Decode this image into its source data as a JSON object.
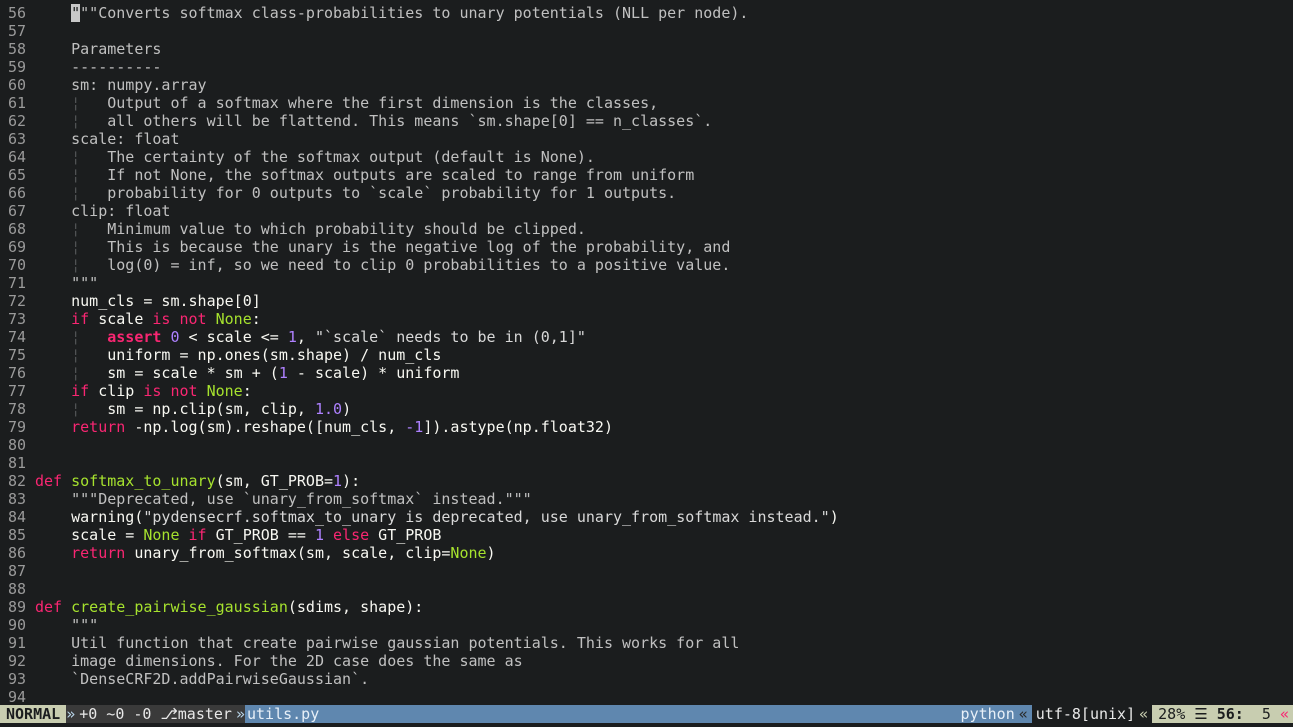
{
  "editor": {
    "lines": [
      {
        "n": "56",
        "tokens": [
          {
            "c": "t-plain",
            "t": "    "
          },
          {
            "c": "t-cursor",
            "t": "\""
          },
          {
            "c": "t-cm",
            "t": "\"\"Converts softmax class-probabilities to unary potentials (NLL per node)."
          }
        ]
      },
      {
        "n": "57",
        "tokens": []
      },
      {
        "n": "58",
        "tokens": [
          {
            "c": "t-cm",
            "t": "    Parameters"
          }
        ]
      },
      {
        "n": "59",
        "tokens": [
          {
            "c": "t-cm",
            "t": "    ----------"
          }
        ]
      },
      {
        "n": "60",
        "tokens": [
          {
            "c": "t-cm",
            "t": "    sm: numpy.array"
          }
        ]
      },
      {
        "n": "61",
        "tokens": [
          {
            "c": "t-plain",
            "t": "    "
          },
          {
            "c": "t-guide",
            "t": "¦"
          },
          {
            "c": "t-cm",
            "t": "   Output of a softmax where the first dimension is the classes,"
          }
        ]
      },
      {
        "n": "62",
        "tokens": [
          {
            "c": "t-plain",
            "t": "    "
          },
          {
            "c": "t-guide",
            "t": "¦"
          },
          {
            "c": "t-cm",
            "t": "   all others will be flattend. This means `sm.shape[0] == n_classes`."
          }
        ]
      },
      {
        "n": "63",
        "tokens": [
          {
            "c": "t-cm",
            "t": "    scale: float"
          }
        ]
      },
      {
        "n": "64",
        "tokens": [
          {
            "c": "t-plain",
            "t": "    "
          },
          {
            "c": "t-guide",
            "t": "¦"
          },
          {
            "c": "t-cm",
            "t": "   The certainty of the softmax output (default is None)."
          }
        ]
      },
      {
        "n": "65",
        "tokens": [
          {
            "c": "t-plain",
            "t": "    "
          },
          {
            "c": "t-guide",
            "t": "¦"
          },
          {
            "c": "t-cm",
            "t": "   If not None, the softmax outputs are scaled to range from uniform"
          }
        ]
      },
      {
        "n": "66",
        "tokens": [
          {
            "c": "t-plain",
            "t": "    "
          },
          {
            "c": "t-guide",
            "t": "¦"
          },
          {
            "c": "t-cm",
            "t": "   probability for 0 outputs to `scale` probability for 1 outputs."
          }
        ]
      },
      {
        "n": "67",
        "tokens": [
          {
            "c": "t-cm",
            "t": "    clip: float"
          }
        ]
      },
      {
        "n": "68",
        "tokens": [
          {
            "c": "t-plain",
            "t": "    "
          },
          {
            "c": "t-guide",
            "t": "¦"
          },
          {
            "c": "t-cm",
            "t": "   Minimum value to which probability should be clipped."
          }
        ]
      },
      {
        "n": "69",
        "tokens": [
          {
            "c": "t-plain",
            "t": "    "
          },
          {
            "c": "t-guide",
            "t": "¦"
          },
          {
            "c": "t-cm",
            "t": "   This is because the unary is the negative log of the probability, and"
          }
        ]
      },
      {
        "n": "70",
        "tokens": [
          {
            "c": "t-plain",
            "t": "    "
          },
          {
            "c": "t-guide",
            "t": "¦"
          },
          {
            "c": "t-cm",
            "t": "   log(0) = inf, so we need to clip 0 probabilities to a positive value."
          }
        ]
      },
      {
        "n": "71",
        "tokens": [
          {
            "c": "t-cm",
            "t": "    \"\"\""
          }
        ]
      },
      {
        "n": "72",
        "tokens": [
          {
            "c": "t-plain",
            "t": "    num_cls = sm.shape[0]"
          }
        ]
      },
      {
        "n": "73",
        "tokens": [
          {
            "c": "t-plain",
            "t": "    "
          },
          {
            "c": "t-kw",
            "t": "if"
          },
          {
            "c": "t-plain",
            "t": " scale "
          },
          {
            "c": "t-kw",
            "t": "is not"
          },
          {
            "c": "t-plain",
            "t": " "
          },
          {
            "c": "t-fn",
            "t": "None"
          },
          {
            "c": "t-plain",
            "t": ":"
          }
        ]
      },
      {
        "n": "74",
        "tokens": [
          {
            "c": "t-plain",
            "t": "    "
          },
          {
            "c": "t-guide",
            "t": "¦"
          },
          {
            "c": "t-plain",
            "t": "   "
          },
          {
            "c": "t-kwbold",
            "t": "assert"
          },
          {
            "c": "t-plain",
            "t": " "
          },
          {
            "c": "t-num",
            "t": "0"
          },
          {
            "c": "t-plain",
            "t": " < scale <= "
          },
          {
            "c": "t-num",
            "t": "1"
          },
          {
            "c": "t-plain",
            "t": ", "
          },
          {
            "c": "t-str",
            "t": "\"`scale` needs to be in (0,1]\""
          }
        ]
      },
      {
        "n": "75",
        "tokens": [
          {
            "c": "t-plain",
            "t": "    "
          },
          {
            "c": "t-guide",
            "t": "¦"
          },
          {
            "c": "t-plain",
            "t": "   uniform = np.ones(sm.shape) / num_cls"
          }
        ]
      },
      {
        "n": "76",
        "tokens": [
          {
            "c": "t-plain",
            "t": "    "
          },
          {
            "c": "t-guide",
            "t": "¦"
          },
          {
            "c": "t-plain",
            "t": "   sm = scale * sm + ("
          },
          {
            "c": "t-num",
            "t": "1"
          },
          {
            "c": "t-plain",
            "t": " - scale) * uniform"
          }
        ]
      },
      {
        "n": "77",
        "tokens": [
          {
            "c": "t-plain",
            "t": "    "
          },
          {
            "c": "t-kw",
            "t": "if"
          },
          {
            "c": "t-plain",
            "t": " clip "
          },
          {
            "c": "t-kw",
            "t": "is not"
          },
          {
            "c": "t-plain",
            "t": " "
          },
          {
            "c": "t-fn",
            "t": "None"
          },
          {
            "c": "t-plain",
            "t": ":"
          }
        ]
      },
      {
        "n": "78",
        "tokens": [
          {
            "c": "t-plain",
            "t": "    "
          },
          {
            "c": "t-guide",
            "t": "¦"
          },
          {
            "c": "t-plain",
            "t": "   sm = np.clip(sm, clip, "
          },
          {
            "c": "t-num",
            "t": "1.0"
          },
          {
            "c": "t-plain",
            "t": ")"
          }
        ]
      },
      {
        "n": "79",
        "tokens": [
          {
            "c": "t-plain",
            "t": "    "
          },
          {
            "c": "t-kw",
            "t": "return"
          },
          {
            "c": "t-plain",
            "t": " -np.log(sm).reshape([num_cls, "
          },
          {
            "c": "t-num",
            "t": "-1"
          },
          {
            "c": "t-plain",
            "t": "]).astype(np.float32)"
          }
        ]
      },
      {
        "n": "80",
        "tokens": []
      },
      {
        "n": "81",
        "tokens": []
      },
      {
        "n": "82",
        "tokens": [
          {
            "c": "t-kw",
            "t": "def"
          },
          {
            "c": "t-plain",
            "t": " "
          },
          {
            "c": "t-fn",
            "t": "softmax_to_unary"
          },
          {
            "c": "t-plain",
            "t": "(sm, GT_PROB="
          },
          {
            "c": "t-num",
            "t": "1"
          },
          {
            "c": "t-plain",
            "t": "):"
          }
        ]
      },
      {
        "n": "83",
        "tokens": [
          {
            "c": "t-cm",
            "t": "    \"\"\"Deprecated, use `unary_from_softmax` instead.\"\"\""
          }
        ]
      },
      {
        "n": "84",
        "tokens": [
          {
            "c": "t-plain",
            "t": "    warning("
          },
          {
            "c": "t-str",
            "t": "\"pydensecrf.softmax_to_unary is deprecated, use unary_from_softmax instead.\""
          },
          {
            "c": "t-plain",
            "t": ")"
          }
        ]
      },
      {
        "n": "85",
        "tokens": [
          {
            "c": "t-plain",
            "t": "    scale = "
          },
          {
            "c": "t-fn",
            "t": "None"
          },
          {
            "c": "t-plain",
            "t": " "
          },
          {
            "c": "t-kw",
            "t": "if"
          },
          {
            "c": "t-plain",
            "t": " GT_PROB == "
          },
          {
            "c": "t-num",
            "t": "1"
          },
          {
            "c": "t-plain",
            "t": " "
          },
          {
            "c": "t-kw",
            "t": "else"
          },
          {
            "c": "t-plain",
            "t": " GT_PROB"
          }
        ]
      },
      {
        "n": "86",
        "tokens": [
          {
            "c": "t-plain",
            "t": "    "
          },
          {
            "c": "t-kw",
            "t": "return"
          },
          {
            "c": "t-plain",
            "t": " unary_from_softmax(sm, scale, clip="
          },
          {
            "c": "t-fn",
            "t": "None"
          },
          {
            "c": "t-plain",
            "t": ")"
          }
        ]
      },
      {
        "n": "87",
        "tokens": []
      },
      {
        "n": "88",
        "tokens": []
      },
      {
        "n": "89",
        "tokens": [
          {
            "c": "t-kw",
            "t": "def"
          },
          {
            "c": "t-plain",
            "t": " "
          },
          {
            "c": "t-fn",
            "t": "create_pairwise_gaussian"
          },
          {
            "c": "t-plain",
            "t": "(sdims, shape):"
          }
        ]
      },
      {
        "n": "90",
        "tokens": [
          {
            "c": "t-cm",
            "t": "    \"\"\""
          }
        ]
      },
      {
        "n": "91",
        "tokens": [
          {
            "c": "t-cm",
            "t": "    Util function that create pairwise gaussian potentials. This works for all"
          }
        ]
      },
      {
        "n": "92",
        "tokens": [
          {
            "c": "t-cm",
            "t": "    image dimensions. For the 2D case does the same as"
          }
        ]
      },
      {
        "n": "93",
        "tokens": [
          {
            "c": "t-cm",
            "t": "    `DenseCRF2D.addPairwiseGaussian`."
          }
        ]
      },
      {
        "n": "94",
        "tokens": []
      }
    ]
  },
  "statusline": {
    "mode": "NORMAL",
    "sep_mode": "»",
    "git": "+0 ~0 -0 ⎇master",
    "sep_git": "»",
    "file": "utils.py",
    "filetype": "python",
    "sep_ft": "«",
    "encoding": "utf-8[unix]",
    "sep_enc": "«",
    "percent": "28%",
    "lines_icon": "☰",
    "line": "56:",
    "col": "5",
    "end_arrow": "«"
  }
}
